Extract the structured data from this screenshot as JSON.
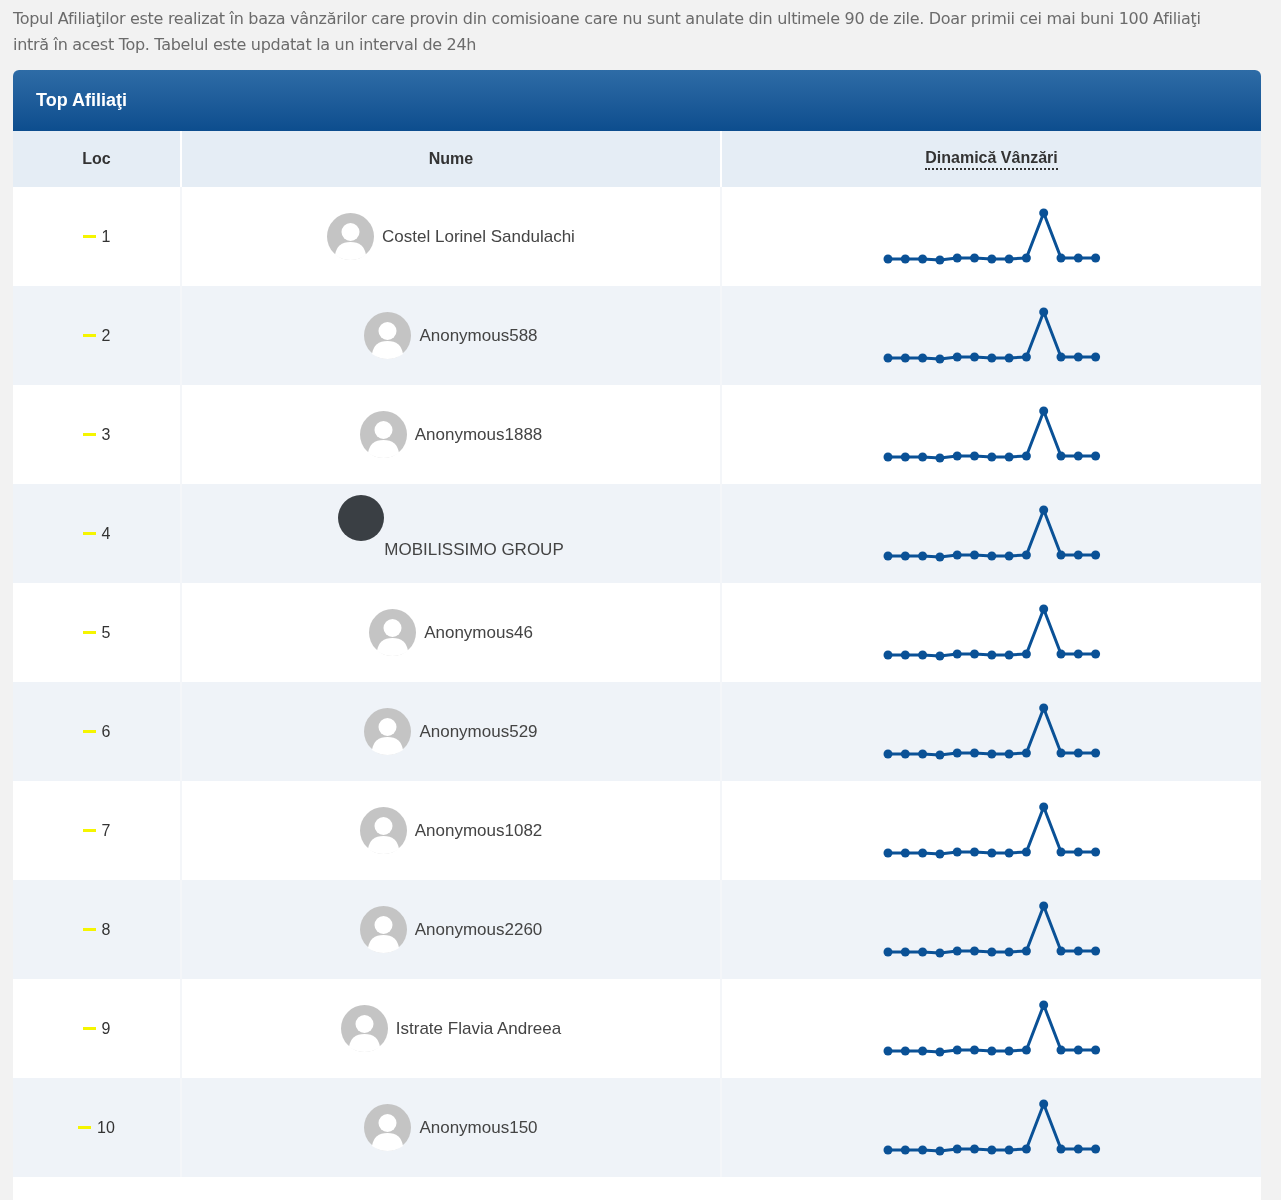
{
  "intro": "Topul Afiliaţilor este realizat în baza vânzărilor care provin din comisioane care nu sunt anulate din ultimele 90 de zile. Doar primii cei mai buni 100 Afiliaţi intră în acest Top. Tabelul este updatat la un interval de 24h",
  "panel": {
    "title": "Top Afiliaţi"
  },
  "columns": [
    "Loc",
    "Nume",
    "Dinamică Vânzări"
  ],
  "rows": [
    {
      "rank": "1",
      "unchanged": true,
      "kind": "silhouette",
      "name": "Costel Lorinel Sandulachi"
    },
    {
      "rank": "2",
      "unchanged": true,
      "kind": "silhouette",
      "name": "Anonymous588"
    },
    {
      "rank": "3",
      "unchanged": true,
      "kind": "silhouette",
      "name": "Anonymous1888"
    },
    {
      "rank": "4",
      "unchanged": true,
      "kind": "photo",
      "name": "MOBILISSIMO GROUP"
    },
    {
      "rank": "5",
      "unchanged": true,
      "kind": "silhouette",
      "name": "Anonymous46"
    },
    {
      "rank": "6",
      "unchanged": true,
      "kind": "silhouette",
      "name": "Anonymous529"
    },
    {
      "rank": "7",
      "unchanged": true,
      "kind": "silhouette",
      "name": "Anonymous1082"
    },
    {
      "rank": "8",
      "unchanged": true,
      "kind": "silhouette",
      "name": "Anonymous2260"
    },
    {
      "rank": "9",
      "unchanged": true,
      "kind": "silhouette",
      "name": "Istrate Flavia Andreea"
    },
    {
      "rank": "10",
      "unchanged": true,
      "kind": "silhouette",
      "name": "Anonymous150"
    }
  ]
}
